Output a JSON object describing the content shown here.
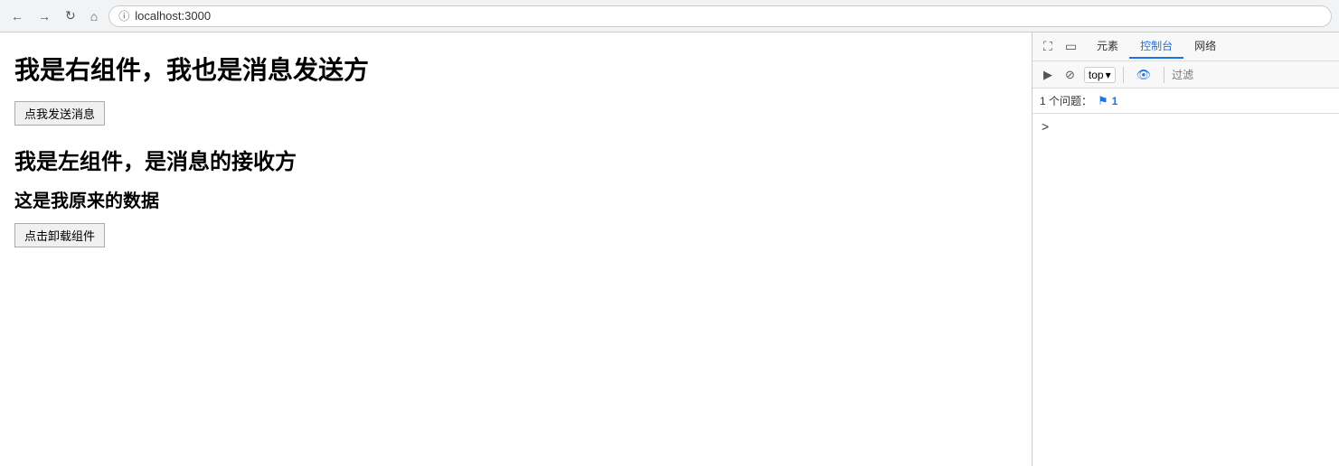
{
  "browser": {
    "url": "localhost:3000",
    "back_label": "←",
    "forward_label": "→",
    "reload_label": "↻",
    "home_label": "⌂"
  },
  "web": {
    "right_component_title": "我是右组件，我也是消息发送方",
    "send_button_label": "点我发送消息",
    "left_component_title": "我是左组件，是消息的接收方",
    "data_label": "这是我原来的数据",
    "unload_button_label": "点击卸载组件"
  },
  "devtools": {
    "toolbar": {
      "cursor_icon": "⛶",
      "device_icon": "▭",
      "play_icon": "▶",
      "ban_icon": "⊘",
      "top_label": "top",
      "chevron": "▾",
      "eye_icon": "👁",
      "filter_placeholder": "过滤"
    },
    "tabs": [
      {
        "label": "元素",
        "active": false
      },
      {
        "label": "控制台",
        "active": true
      },
      {
        "label": "网络",
        "active": false
      }
    ],
    "issues": {
      "label": "1 个问题：",
      "icon": "⚑",
      "count": "1"
    },
    "console_arrow": ">"
  }
}
